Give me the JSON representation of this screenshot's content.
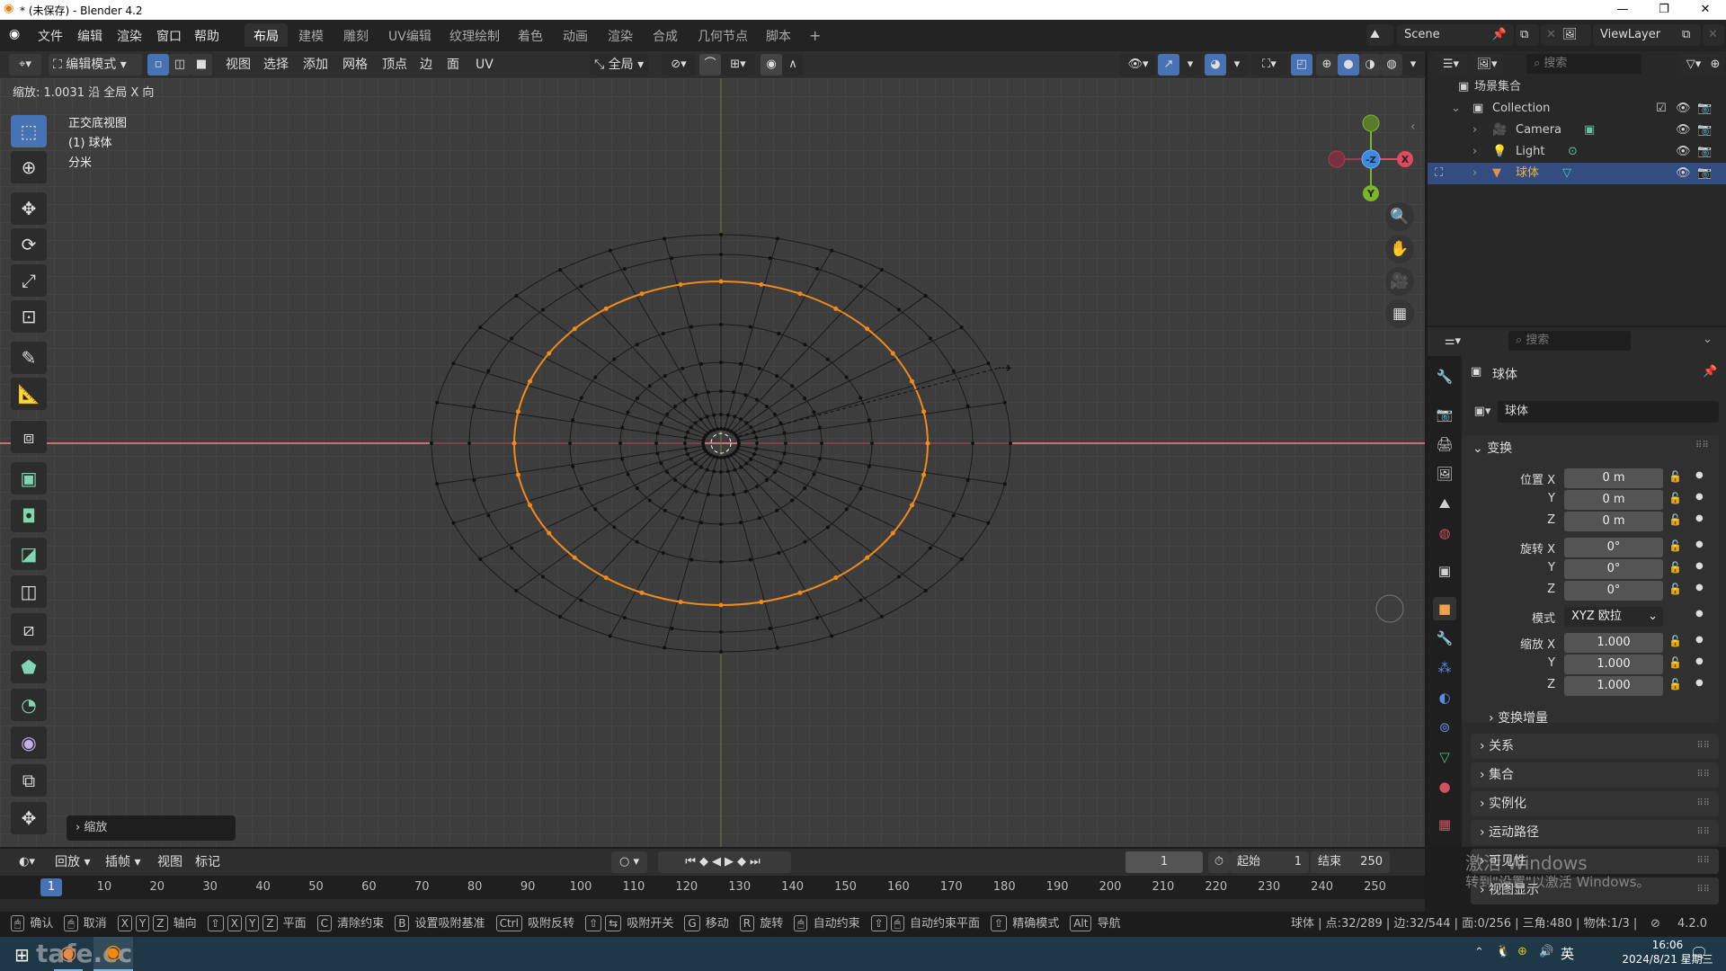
{
  "window": {
    "title": "* (未保存) - Blender 4.2",
    "min_icon": "minimize-icon",
    "max_icon": "restore-icon",
    "close_icon": "close-icon"
  },
  "menu": {
    "items": [
      "文件",
      "编辑",
      "渲染",
      "窗口",
      "帮助"
    ]
  },
  "workspaces": {
    "tabs": [
      "布局",
      "建模",
      "雕刻",
      "UV编辑",
      "纹理绘制",
      "着色",
      "动画",
      "渲染",
      "合成",
      "几何节点",
      "脚本"
    ],
    "active": "布局",
    "add": "+"
  },
  "scene": {
    "scene_name": "Scene",
    "view_layer": "ViewLayer"
  },
  "viewport_header": {
    "mode": "编辑模式",
    "menus": [
      "视图",
      "选择",
      "添加",
      "网格",
      "顶点",
      "边",
      "面",
      "UV"
    ],
    "transform_orientation": "全局"
  },
  "viewport": {
    "operator_info": "缩放: 1.0031 沿 全局 X 向",
    "view_name": "正交底视图",
    "object_label": "(1) 球体",
    "unit_label": "分米",
    "last_operator": "缩放",
    "gizmo": {
      "x": "X",
      "y": "Y",
      "z": "-Z"
    },
    "colors": {
      "selected_edge": "#f08a1c",
      "x_axis": "#e04a5f",
      "y_axis": "#7ab52a",
      "z_axis": "#3c8ae0"
    }
  },
  "outliner": {
    "search_placeholder": "搜索",
    "root": "场景集合",
    "collection": "Collection",
    "items": [
      {
        "name": "Camera",
        "type": "camera"
      },
      {
        "name": "Light",
        "type": "light"
      },
      {
        "name": "球体",
        "type": "mesh",
        "selected": true
      }
    ]
  },
  "properties": {
    "search_placeholder": "搜索",
    "object_name": "球体",
    "object_name_field": "球体",
    "transform_label": "变换",
    "location_label": "位置",
    "rotation_label": "旋转",
    "mode_label": "模式",
    "scale_label": "缩放",
    "axes": [
      "X",
      "Y",
      "Z"
    ],
    "location": [
      "0 m",
      "0 m",
      "0 m"
    ],
    "rotation": [
      "0°",
      "0°",
      "0°"
    ],
    "rotation_mode": "XYZ 欧拉",
    "scale": [
      "1.000",
      "1.000",
      "1.000"
    ],
    "delta_label": "变换增量",
    "panels": [
      "关系",
      "集合",
      "实例化",
      "运动路径",
      "可见性",
      "视图显示"
    ]
  },
  "timeline": {
    "menus": [
      "回放",
      "插帧",
      "视图",
      "标记"
    ],
    "current_frame": "1",
    "start_label": "起始",
    "start": "1",
    "end_label": "结束",
    "end": "250",
    "ticks": [
      "10",
      "20",
      "30",
      "40",
      "50",
      "60",
      "70",
      "80",
      "90",
      "100",
      "110",
      "120",
      "130",
      "140",
      "150",
      "160",
      "170",
      "180",
      "190",
      "200",
      "210",
      "220",
      "230",
      "240",
      "250"
    ],
    "playhead": "1"
  },
  "statusbar": {
    "hints": [
      {
        "keys": [
          "🖱"
        ],
        "label": "确认"
      },
      {
        "keys": [
          "🖱"
        ],
        "label": "取消"
      },
      {
        "keys": [
          "X",
          "Y",
          "Z"
        ],
        "label": "轴向"
      },
      {
        "keys": [
          "⇧",
          "X",
          "Y",
          "Z"
        ],
        "label": "平面"
      },
      {
        "keys": [
          "C"
        ],
        "label": "清除约束"
      },
      {
        "keys": [
          "B"
        ],
        "label": "设置吸附基准"
      },
      {
        "keys": [
          "Ctrl"
        ],
        "label": "吸附反转"
      },
      {
        "keys": [
          "⇧",
          "⇆"
        ],
        "label": "吸附开关"
      },
      {
        "keys": [
          "G"
        ],
        "label": "移动"
      },
      {
        "keys": [
          "R"
        ],
        "label": "旋转"
      },
      {
        "keys": [
          "🖱"
        ],
        "label": "自动约束"
      },
      {
        "keys": [
          "⇧",
          "🖱"
        ],
        "label": "自动约束平面"
      },
      {
        "keys": [
          "⇧"
        ],
        "label": "精确模式"
      },
      {
        "keys": [
          "Alt"
        ],
        "label": "导航"
      }
    ],
    "stats": "球体 | 点:32/289 | 边:32/544 | 面:0/256 | 三角:480 | 物体:1/3 |",
    "version": "4.2.0"
  },
  "watermark": {
    "line1": "激活 Windows",
    "line2": "转到\"设置\"以激活 Windows。"
  },
  "taskbar": {
    "time": "16:06",
    "date": "2024/8/21 星期三",
    "ime": "英",
    "logo_text": "tafe.cc"
  }
}
